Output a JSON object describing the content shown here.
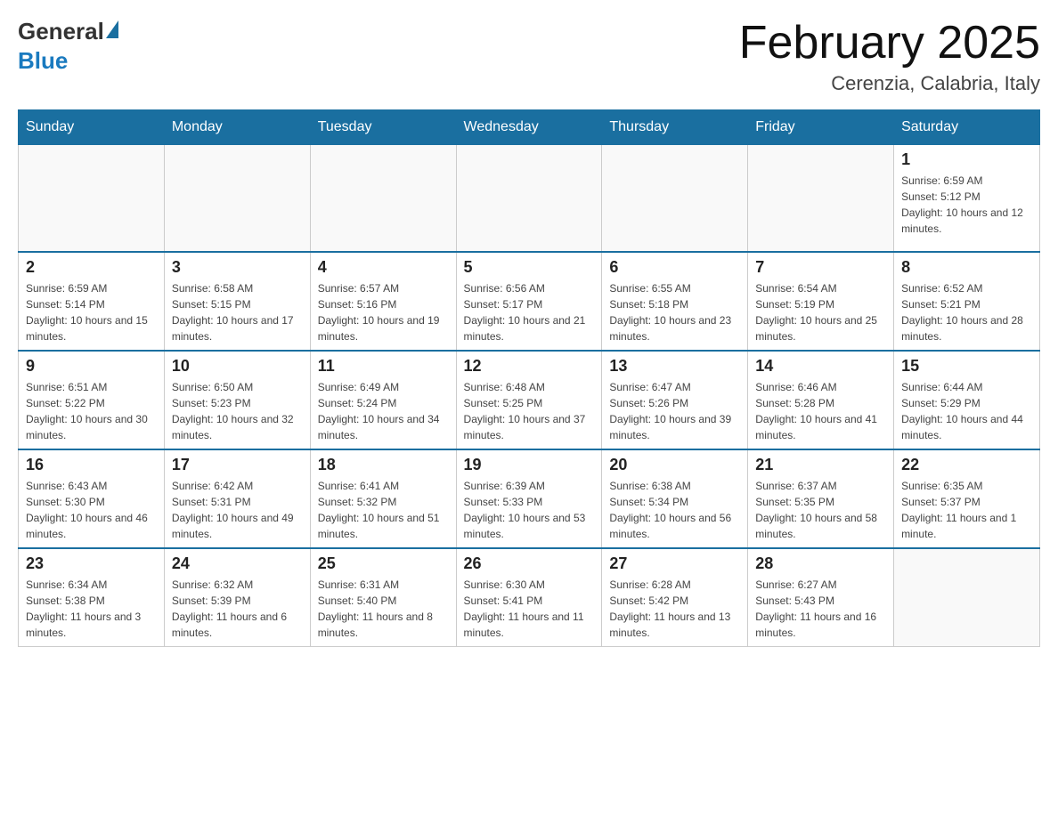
{
  "header": {
    "logo_general": "General",
    "logo_blue": "Blue",
    "month_title": "February 2025",
    "location": "Cerenzia, Calabria, Italy"
  },
  "weekdays": [
    "Sunday",
    "Monday",
    "Tuesday",
    "Wednesday",
    "Thursday",
    "Friday",
    "Saturday"
  ],
  "weeks": [
    [
      {
        "day": "",
        "info": ""
      },
      {
        "day": "",
        "info": ""
      },
      {
        "day": "",
        "info": ""
      },
      {
        "day": "",
        "info": ""
      },
      {
        "day": "",
        "info": ""
      },
      {
        "day": "",
        "info": ""
      },
      {
        "day": "1",
        "info": "Sunrise: 6:59 AM\nSunset: 5:12 PM\nDaylight: 10 hours and 12 minutes."
      }
    ],
    [
      {
        "day": "2",
        "info": "Sunrise: 6:59 AM\nSunset: 5:14 PM\nDaylight: 10 hours and 15 minutes."
      },
      {
        "day": "3",
        "info": "Sunrise: 6:58 AM\nSunset: 5:15 PM\nDaylight: 10 hours and 17 minutes."
      },
      {
        "day": "4",
        "info": "Sunrise: 6:57 AM\nSunset: 5:16 PM\nDaylight: 10 hours and 19 minutes."
      },
      {
        "day": "5",
        "info": "Sunrise: 6:56 AM\nSunset: 5:17 PM\nDaylight: 10 hours and 21 minutes."
      },
      {
        "day": "6",
        "info": "Sunrise: 6:55 AM\nSunset: 5:18 PM\nDaylight: 10 hours and 23 minutes."
      },
      {
        "day": "7",
        "info": "Sunrise: 6:54 AM\nSunset: 5:19 PM\nDaylight: 10 hours and 25 minutes."
      },
      {
        "day": "8",
        "info": "Sunrise: 6:52 AM\nSunset: 5:21 PM\nDaylight: 10 hours and 28 minutes."
      }
    ],
    [
      {
        "day": "9",
        "info": "Sunrise: 6:51 AM\nSunset: 5:22 PM\nDaylight: 10 hours and 30 minutes."
      },
      {
        "day": "10",
        "info": "Sunrise: 6:50 AM\nSunset: 5:23 PM\nDaylight: 10 hours and 32 minutes."
      },
      {
        "day": "11",
        "info": "Sunrise: 6:49 AM\nSunset: 5:24 PM\nDaylight: 10 hours and 34 minutes."
      },
      {
        "day": "12",
        "info": "Sunrise: 6:48 AM\nSunset: 5:25 PM\nDaylight: 10 hours and 37 minutes."
      },
      {
        "day": "13",
        "info": "Sunrise: 6:47 AM\nSunset: 5:26 PM\nDaylight: 10 hours and 39 minutes."
      },
      {
        "day": "14",
        "info": "Sunrise: 6:46 AM\nSunset: 5:28 PM\nDaylight: 10 hours and 41 minutes."
      },
      {
        "day": "15",
        "info": "Sunrise: 6:44 AM\nSunset: 5:29 PM\nDaylight: 10 hours and 44 minutes."
      }
    ],
    [
      {
        "day": "16",
        "info": "Sunrise: 6:43 AM\nSunset: 5:30 PM\nDaylight: 10 hours and 46 minutes."
      },
      {
        "day": "17",
        "info": "Sunrise: 6:42 AM\nSunset: 5:31 PM\nDaylight: 10 hours and 49 minutes."
      },
      {
        "day": "18",
        "info": "Sunrise: 6:41 AM\nSunset: 5:32 PM\nDaylight: 10 hours and 51 minutes."
      },
      {
        "day": "19",
        "info": "Sunrise: 6:39 AM\nSunset: 5:33 PM\nDaylight: 10 hours and 53 minutes."
      },
      {
        "day": "20",
        "info": "Sunrise: 6:38 AM\nSunset: 5:34 PM\nDaylight: 10 hours and 56 minutes."
      },
      {
        "day": "21",
        "info": "Sunrise: 6:37 AM\nSunset: 5:35 PM\nDaylight: 10 hours and 58 minutes."
      },
      {
        "day": "22",
        "info": "Sunrise: 6:35 AM\nSunset: 5:37 PM\nDaylight: 11 hours and 1 minute."
      }
    ],
    [
      {
        "day": "23",
        "info": "Sunrise: 6:34 AM\nSunset: 5:38 PM\nDaylight: 11 hours and 3 minutes."
      },
      {
        "day": "24",
        "info": "Sunrise: 6:32 AM\nSunset: 5:39 PM\nDaylight: 11 hours and 6 minutes."
      },
      {
        "day": "25",
        "info": "Sunrise: 6:31 AM\nSunset: 5:40 PM\nDaylight: 11 hours and 8 minutes."
      },
      {
        "day": "26",
        "info": "Sunrise: 6:30 AM\nSunset: 5:41 PM\nDaylight: 11 hours and 11 minutes."
      },
      {
        "day": "27",
        "info": "Sunrise: 6:28 AM\nSunset: 5:42 PM\nDaylight: 11 hours and 13 minutes."
      },
      {
        "day": "28",
        "info": "Sunrise: 6:27 AM\nSunset: 5:43 PM\nDaylight: 11 hours and 16 minutes."
      },
      {
        "day": "",
        "info": ""
      }
    ]
  ]
}
